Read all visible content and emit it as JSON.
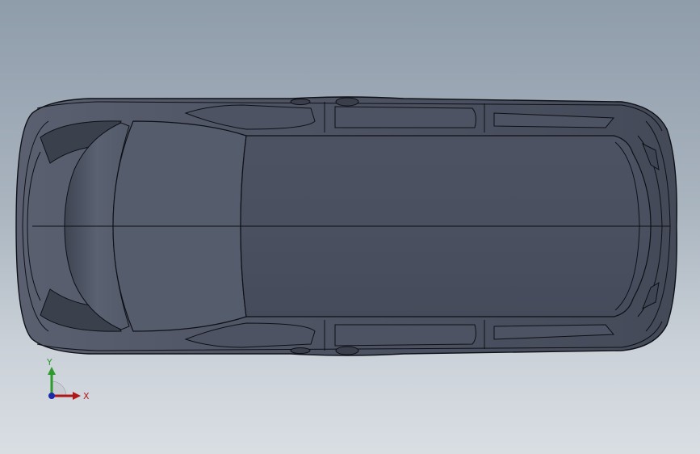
{
  "viewport": {
    "background_top": "#8f9caa",
    "background_bottom": "#d9dee3"
  },
  "model": {
    "body_color": "#4a5060",
    "edge_color": "#0e1016",
    "view": "top"
  },
  "triad": {
    "y_label": "Y",
    "x_label": "X",
    "y_color": "#2e9a2e",
    "x_color": "#b01818",
    "z_color": "#1a2aa8"
  }
}
